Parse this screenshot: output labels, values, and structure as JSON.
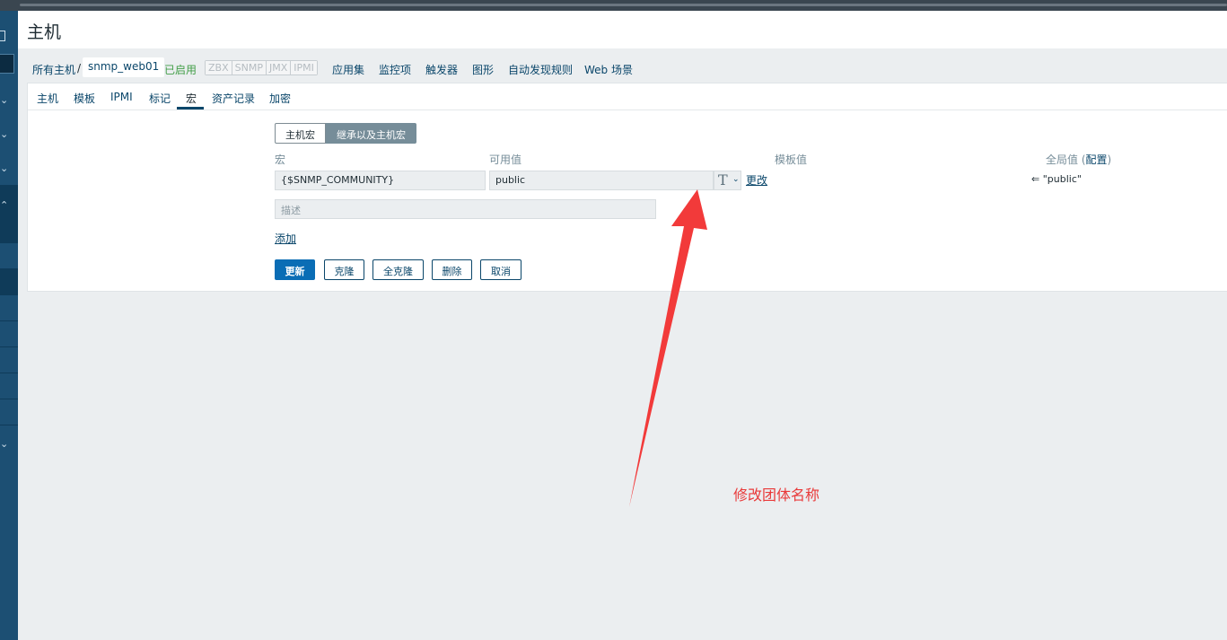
{
  "page": {
    "title": "主机"
  },
  "sidebar": {
    "chevrons": [
      "⌄",
      "⌄",
      "⌄",
      "⌃",
      "⌄"
    ]
  },
  "breadcrumb": {
    "all_hosts": "所有主机",
    "separator": "/",
    "current_host": "snmp_web01",
    "status": "已启用",
    "protocols": [
      "ZBX",
      "SNMP",
      "JMX",
      "IPMI"
    ],
    "links": [
      "应用集",
      "监控项",
      "触发器",
      "图形",
      "自动发现规则",
      "Web 场景"
    ]
  },
  "tabs": [
    {
      "label": "主机"
    },
    {
      "label": "模板"
    },
    {
      "label": "IPMI"
    },
    {
      "label": "标记"
    },
    {
      "label": "宏"
    },
    {
      "label": "资产记录"
    },
    {
      "label": "加密"
    }
  ],
  "macro_toggle": {
    "host_macros": "主机宏",
    "inherited_macros": "继承以及主机宏"
  },
  "columns": {
    "macro": "宏",
    "effective_value": "可用值",
    "template_value": "模板值",
    "global_value": "全局值",
    "config_link": "配置"
  },
  "macro_row": {
    "name": "{$SNMP_COMMUNITY}",
    "value": "public",
    "change_link": "更改",
    "global_value": "⇐ \"public\"",
    "description_placeholder": "描述"
  },
  "add_link": "添加",
  "buttons": {
    "update": "更新",
    "clone": "克隆",
    "full_clone": "全克隆",
    "delete": "删除",
    "cancel": "取消"
  },
  "annotation": {
    "text": "修改团体名称",
    "color": "#e93a3a"
  },
  "colors": {
    "sidebar": "#1c4f73",
    "primary_button": "#0a6db5",
    "link": "#0a466a",
    "enabled": "#429e47"
  }
}
